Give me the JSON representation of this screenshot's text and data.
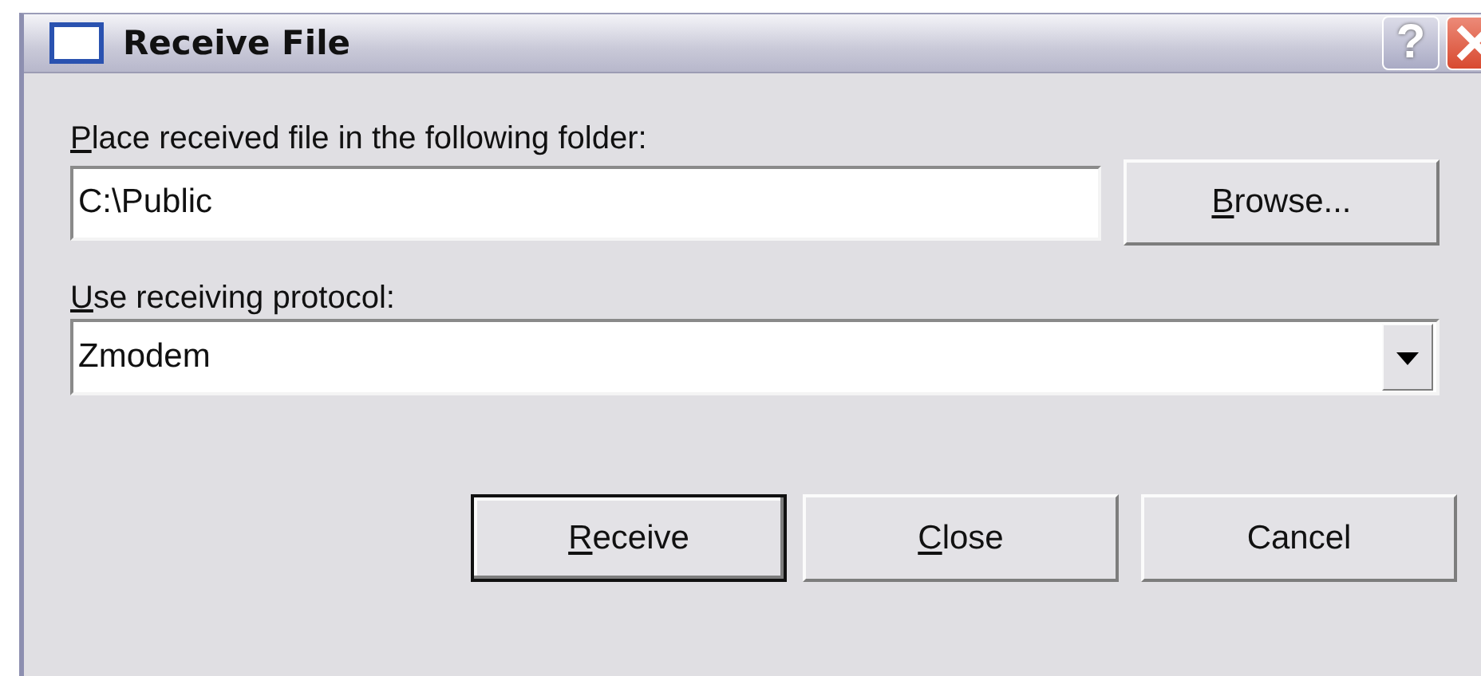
{
  "window": {
    "title": "Receive File"
  },
  "title_buttons": [
    {
      "kind": "help",
      "label": "?"
    },
    {
      "kind": "close"
    }
  ],
  "folder": {
    "access_key": "P",
    "label": "lace received file in the following folder:",
    "value": "C:\\Public"
  },
  "browse_button": {
    "access_key": "B",
    "label": "rowse..."
  },
  "protocol": {
    "access_key": "U",
    "label": "se receiving protocol:",
    "value": "Zmodem"
  },
  "buttons": [
    {
      "access_key": "R",
      "label": "eceive",
      "default": true
    },
    {
      "access_key": "C",
      "label": "lose",
      "default": false
    },
    {
      "label": "Cancel",
      "default": false
    }
  ]
}
